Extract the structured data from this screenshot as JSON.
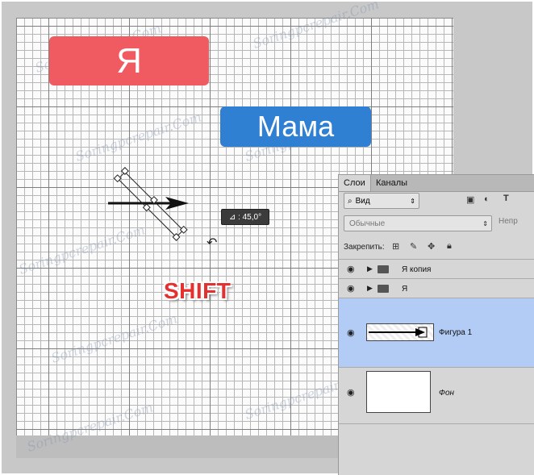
{
  "canvas": {
    "ya_label": "Я",
    "mama_label": "Мама",
    "shift_label": "SHIFT",
    "angle_readout": "⊿ : 45,0°",
    "colors": {
      "ya_box": "#ef5b61",
      "mama_box": "#2f7fd2",
      "shift_text": "#e53030"
    }
  },
  "watermark": "Soringpcrepair.Com",
  "layers_panel": {
    "tabs": [
      "Слои",
      "Каналы"
    ],
    "filter_label": "Вид",
    "blend_mode": "Обычные",
    "opacity_label": "Непр",
    "lock_label": "Закрепить:",
    "layers": [
      {
        "name": "Я копия",
        "type": "group"
      },
      {
        "name": "Я",
        "type": "group"
      },
      {
        "name": "Фигура 1",
        "type": "shape",
        "selected": true
      },
      {
        "name": "Фон",
        "type": "background"
      }
    ]
  }
}
